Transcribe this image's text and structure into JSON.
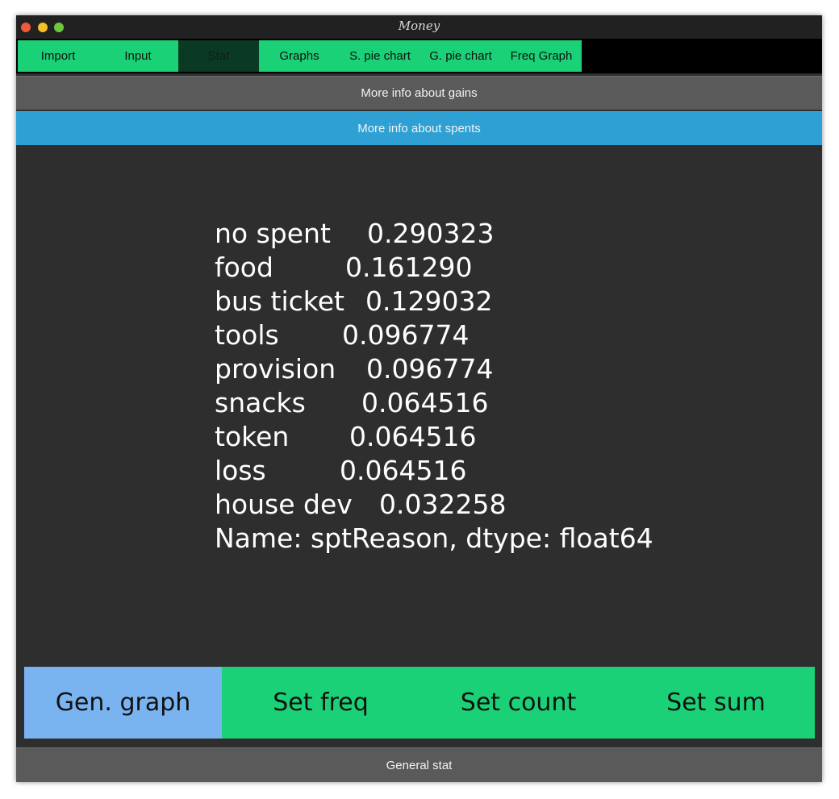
{
  "window": {
    "title": "Money"
  },
  "tabs": [
    {
      "label": "Import",
      "active": false
    },
    {
      "label": "Input",
      "active": false
    },
    {
      "label": "Stat",
      "active": true
    },
    {
      "label": "Graphs",
      "active": false
    },
    {
      "label": "S. pie chart",
      "active": false
    },
    {
      "label": "G. pie chart",
      "active": false
    },
    {
      "label": "Freq Graph",
      "active": false
    }
  ],
  "sections": {
    "gains_label": "More info about gains",
    "spents_label": "More info about spents",
    "general_label": "General stat"
  },
  "stats": {
    "rows": [
      {
        "label": "no spent",
        "value": "0.290323"
      },
      {
        "label": "food",
        "value": "0.161290"
      },
      {
        "label": "bus ticket",
        "value": "0.129032"
      },
      {
        "label": "tools",
        "value": "0.096774"
      },
      {
        "label": "provision",
        "value": "0.096774"
      },
      {
        "label": "snacks",
        "value": "0.064516"
      },
      {
        "label": "token",
        "value": "0.064516"
      },
      {
        "label": "loss",
        "value": "0.064516"
      },
      {
        "label": "house dev",
        "value": "0.032258"
      }
    ],
    "footer": "Name: sptReason, dtype: float64"
  },
  "actions": {
    "gen_graph": "Gen. graph",
    "set_freq": "Set freq",
    "set_count": "Set count",
    "set_sum": "Set sum"
  },
  "colors": {
    "tab_green": "#1bd177",
    "tab_active": "#0a3a24",
    "spents_blue": "#2ea0d4",
    "gen_graph_blue": "#7ab4f0",
    "panel_bg": "#2e2e2e",
    "bar_grey": "#5a5a5a"
  }
}
